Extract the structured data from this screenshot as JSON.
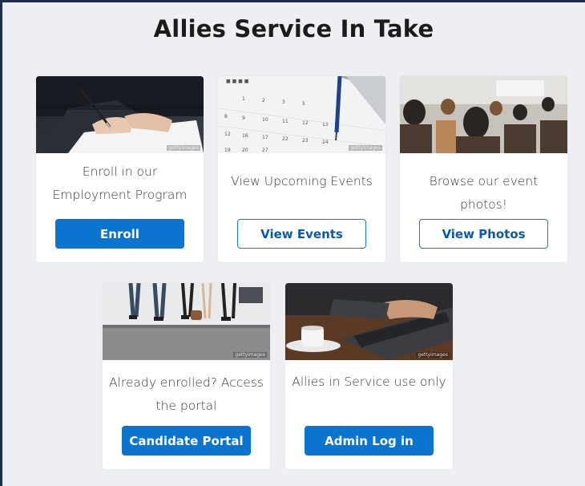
{
  "page": {
    "title": "Allies Service In Take"
  },
  "colors": {
    "primary": "#0a74cf",
    "background": "#edeff2",
    "border": "#1f2f4f"
  },
  "cards": [
    {
      "image": "signing-document-photo",
      "watermark": "gettyimages",
      "text": "Enroll in our Employment Program",
      "button": "Enroll",
      "button_style": "solid"
    },
    {
      "image": "calendar-pen-photo",
      "watermark": "gettyimages",
      "text": "View Upcoming Events",
      "button": "View Events",
      "button_style": "outline"
    },
    {
      "image": "audience-seminar-photo",
      "watermark": "",
      "text": "Browse our event photos!",
      "button": "View Photos",
      "button_style": "outline"
    },
    {
      "image": "people-waiting-chairs-photo",
      "watermark": "gettyimages",
      "text": "Already enrolled? Access the portal",
      "button": "Candidate Portal",
      "button_style": "solid"
    },
    {
      "image": "laptop-coffee-photo",
      "watermark": "gettyimages",
      "text": "Allies in Service use only",
      "button": "Admin Log in",
      "button_style": "solid"
    }
  ]
}
